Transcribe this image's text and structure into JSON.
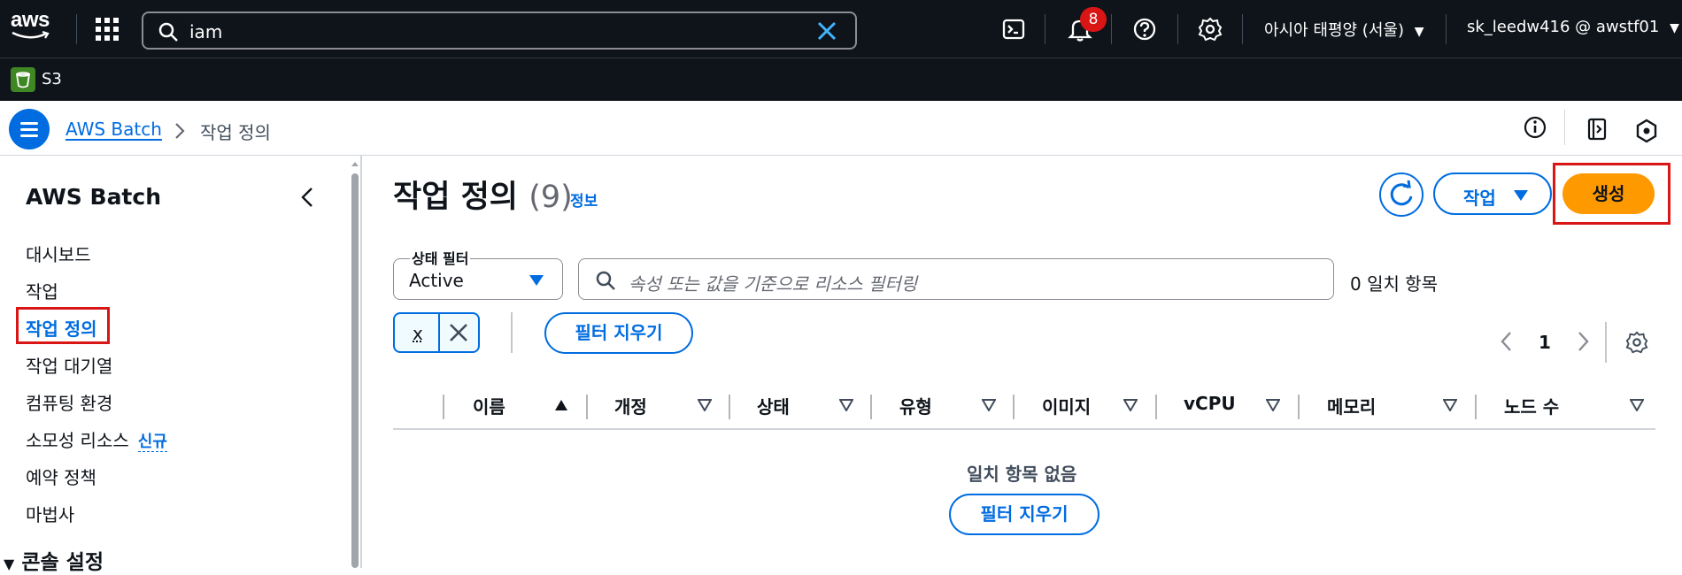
{
  "topnav": {
    "logo_text": "aws",
    "search_value": "iam",
    "notification_count": "8",
    "region": "아시아 태평양 (서울)",
    "account": "sk_leedw416 @ awstf01"
  },
  "service_bar": {
    "pinned": [
      {
        "label": "S3"
      }
    ]
  },
  "breadcrumb": {
    "items": [
      {
        "label": "AWS Batch"
      }
    ],
    "current": "작업 정의"
  },
  "sidebar": {
    "title": "AWS Batch",
    "items": [
      {
        "label": "대시보드"
      },
      {
        "label": "작업"
      },
      {
        "label": "작업 정의"
      },
      {
        "label": "작업 대기열"
      },
      {
        "label": "컴퓨팅 환경"
      },
      {
        "label": "소모성 리소스"
      },
      {
        "label": "예약 정책"
      },
      {
        "label": "마법사"
      }
    ],
    "new_badge": "신규",
    "section": "콘솔 설정"
  },
  "main": {
    "title": "작업 정의",
    "count": "(9)",
    "info": "정보",
    "actions_label": "작업",
    "create_label": "생성",
    "status_filter_label": "상태 필터",
    "status_filter_value": "Active",
    "search_placeholder": "속성 또는 값을 기준으로 리소스 필터링",
    "match_count": "0 일치 항목",
    "token": "x",
    "clear_filter": "필터 지우기",
    "page": "1",
    "columns": [
      "이름",
      "개정",
      "상태",
      "유형",
      "이미지",
      "vCPU",
      "메모리",
      "노드 수"
    ],
    "empty_message": "일치 항목 없음",
    "empty_clear": "필터 지우기"
  },
  "colors": {
    "nav_bg": "#0f141a",
    "link": "#006ce0",
    "primary_button": "#ff9900",
    "highlight": "#d91515",
    "s3": "#3f8624"
  }
}
